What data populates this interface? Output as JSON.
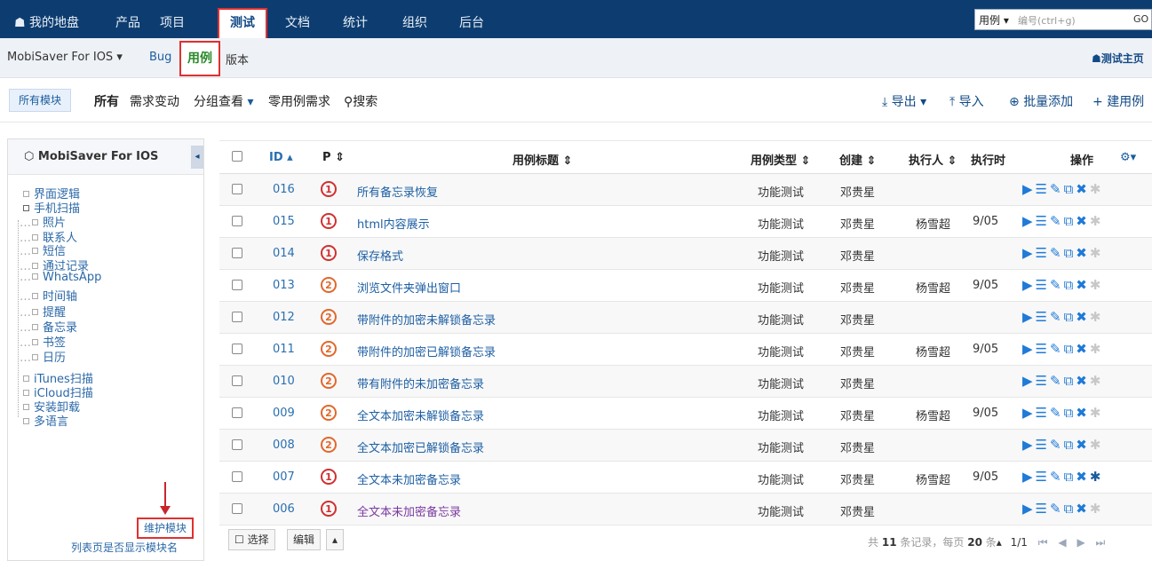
{
  "topnav": {
    "tabs": [
      "我的地盘",
      "产品",
      "项目",
      "测试",
      "文档",
      "统计",
      "组织",
      "后台"
    ],
    "search": {
      "type": "用例",
      "placeholder": "编号(ctrl+g)",
      "go": "GO"
    }
  },
  "subnav": {
    "product": "MobiSaver For IOS",
    "items": [
      "Bug",
      "用例",
      "版本"
    ],
    "home_link": "测试主页"
  },
  "toolbar": {
    "breadcrumb": "所有模块",
    "filters": [
      "所有",
      "需求变动",
      "分组查看",
      "零用例需求",
      "搜索"
    ],
    "right": [
      "导出",
      "导入",
      "批量添加",
      "建用例"
    ]
  },
  "sidebar": {
    "title": "MobiSaver For IOS",
    "tree": [
      {
        "label": "界面逻辑",
        "level": 0
      },
      {
        "label": "手机扫描",
        "level": 0
      },
      {
        "label": "照片",
        "level": 1
      },
      {
        "label": "联系人",
        "level": 1
      },
      {
        "label": "短信",
        "level": 1
      },
      {
        "label": "通过记录",
        "level": 1
      },
      {
        "label": "WhatsApp",
        "level": 1
      },
      {
        "label": "时间轴",
        "level": 1
      },
      {
        "label": "提醒",
        "level": 1
      },
      {
        "label": "备忘录",
        "level": 1
      },
      {
        "label": "书签",
        "level": 1
      },
      {
        "label": "日历",
        "level": 1
      },
      {
        "label": "iTunes扫描",
        "level": 0
      },
      {
        "label": "iCloud扫描",
        "level": 0
      },
      {
        "label": "安装卸载",
        "level": 0
      },
      {
        "label": "多语言",
        "level": 0
      }
    ],
    "maintain": "维护模块",
    "show_module": "列表页是否显示模块名"
  },
  "table": {
    "headers": [
      "ID",
      "P",
      "用例标题",
      "用例类型",
      "创建",
      "执行人",
      "执行时",
      "操作"
    ],
    "rows": [
      {
        "id": "016",
        "pri": "1",
        "title": "所有备忘录恢复",
        "type": "功能测试",
        "creator": "邓贵星",
        "executor": "",
        "date": ""
      },
      {
        "id": "015",
        "pri": "1",
        "title": "html内容展示",
        "type": "功能测试",
        "creator": "邓贵星",
        "executor": "杨雪超",
        "date": "9/05"
      },
      {
        "id": "014",
        "pri": "1",
        "title": "保存格式",
        "type": "功能测试",
        "creator": "邓贵星",
        "executor": "",
        "date": ""
      },
      {
        "id": "013",
        "pri": "2",
        "title": "浏览文件夹弹出窗口",
        "type": "功能测试",
        "creator": "邓贵星",
        "executor": "杨雪超",
        "date": "9/05"
      },
      {
        "id": "012",
        "pri": "2",
        "title": "带附件的加密未解锁备忘录",
        "type": "功能测试",
        "creator": "邓贵星",
        "executor": "",
        "date": ""
      },
      {
        "id": "011",
        "pri": "2",
        "title": "带附件的加密已解锁备忘录",
        "type": "功能测试",
        "creator": "邓贵星",
        "executor": "杨雪超",
        "date": "9/05"
      },
      {
        "id": "010",
        "pri": "2",
        "title": "带有附件的未加密备忘录",
        "type": "功能测试",
        "creator": "邓贵星",
        "executor": "",
        "date": ""
      },
      {
        "id": "009",
        "pri": "2",
        "title": "全文本加密未解锁备忘录",
        "type": "功能测试",
        "creator": "邓贵星",
        "executor": "杨雪超",
        "date": "9/05"
      },
      {
        "id": "008",
        "pri": "2",
        "title": "全文本加密已解锁备忘录",
        "type": "功能测试",
        "creator": "邓贵星",
        "executor": "",
        "date": ""
      },
      {
        "id": "007",
        "pri": "1",
        "title": "全文本未加密备忘录",
        "type": "功能测试",
        "creator": "邓贵星",
        "executor": "杨雪超",
        "date": "9/05"
      },
      {
        "id": "006",
        "pri": "1",
        "title": "全文本未加密备忘录",
        "type": "功能测试",
        "creator": "邓贵星",
        "executor": "",
        "date": ""
      }
    ]
  },
  "footer": {
    "select": "选择",
    "edit": "编辑",
    "pager": {
      "total": "11",
      "per": "20",
      "pages": "1/1",
      "pre": "共",
      "mid": "条记录，每页",
      "post": "条"
    }
  }
}
